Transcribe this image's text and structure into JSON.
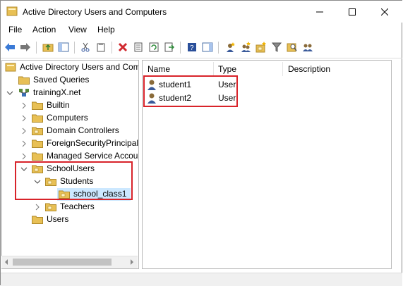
{
  "window": {
    "title": "Active Directory Users and Computers"
  },
  "menu": [
    "File",
    "Action",
    "View",
    "Help"
  ],
  "tree": {
    "root": "Active Directory Users and Com",
    "saved_queries": "Saved Queries",
    "domain": "trainingX.net",
    "builtin": "Builtin",
    "computers": "Computers",
    "domain_controllers": "Domain Controllers",
    "foreign": "ForeignSecurityPrincipals",
    "msa": "Managed Service Accoun",
    "school_users": "SchoolUsers",
    "students": "Students",
    "school_class1": "school_class1",
    "teachers": "Teachers",
    "users": "Users"
  },
  "list": {
    "columns": [
      "Name",
      "Type",
      "Description"
    ],
    "rows": [
      {
        "name": "student1",
        "type": "User",
        "description": ""
      },
      {
        "name": "student2",
        "type": "User",
        "description": ""
      }
    ]
  },
  "colors": {
    "highlight_box": "#d8232a",
    "selection": "#cce8ff",
    "folder": "#e8c055"
  }
}
